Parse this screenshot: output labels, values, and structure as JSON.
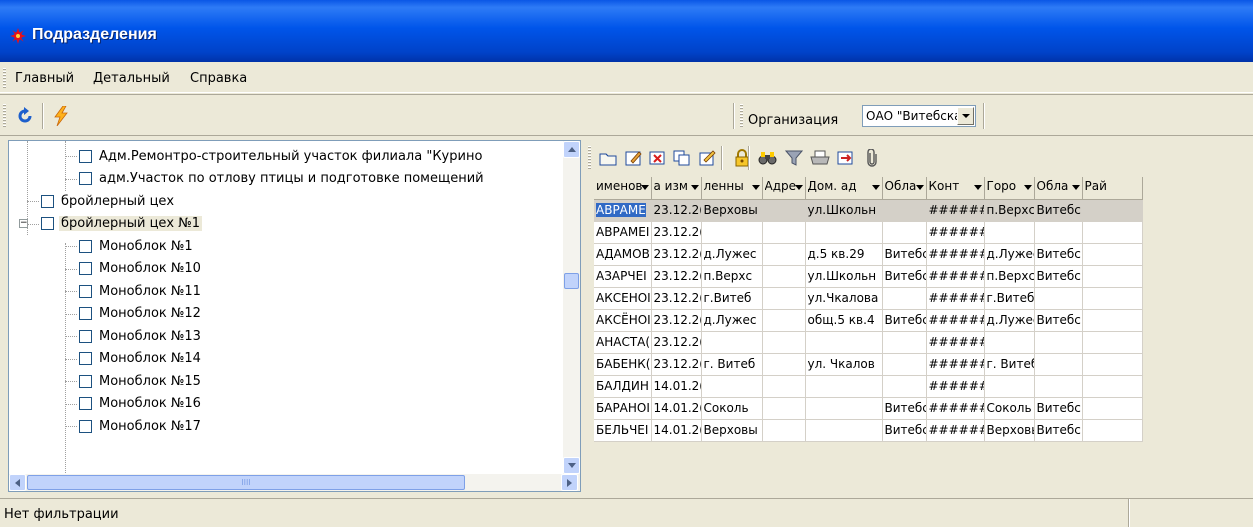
{
  "window": {
    "title": "Подразделения",
    "icon": "red-sun-app-icon"
  },
  "menu": {
    "items": [
      "Главный",
      "Детальный",
      "Справка"
    ]
  },
  "toolbar": {
    "buttons": [
      "refresh-icon",
      "lightning-icon"
    ],
    "org_label": "Организация",
    "org_value": "ОАО \"Витебская бройлерная птиц"
  },
  "tree": {
    "items": [
      {
        "label": "Адм.Ремонтро-строительный участок филиала \"Курино",
        "level": 2
      },
      {
        "label": "адм.Участок по отлову птицы и подготовке помещений",
        "level": 2
      },
      {
        "label": "бройлерный цех",
        "level": 1
      },
      {
        "label": "бройлерный цех №1",
        "level": 1,
        "expanded": true,
        "selected": true
      },
      {
        "label": "Моноблок №1",
        "level": 2
      },
      {
        "label": "Моноблок №10",
        "level": 2
      },
      {
        "label": "Моноблок №11",
        "level": 2
      },
      {
        "label": "Моноблок №12",
        "level": 2
      },
      {
        "label": "Моноблок №13",
        "level": 2
      },
      {
        "label": "Моноблок №14",
        "level": 2
      },
      {
        "label": "Моноблок №15",
        "level": 2
      },
      {
        "label": "Моноблок №16",
        "level": 2
      },
      {
        "label": "Моноблок №17",
        "level": 2
      }
    ],
    "hscroll_marker": "IIII"
  },
  "grid_toolbar": {
    "buttons": [
      "folder-icon",
      "edit-icon",
      "delete-icon",
      "copy-icon",
      "edit-note-icon",
      "lock-icon",
      "binoculars-icon",
      "filter-icon",
      "print-icon",
      "export-icon",
      "paperclip-icon"
    ]
  },
  "grid": {
    "columns": [
      "именов",
      "а изм",
      "ленны",
      "Адре",
      "Дом. ад",
      "Обла",
      "Конт",
      "Горо",
      "Обла",
      "Рай"
    ],
    "rows": [
      [
        "АВРАМЕ",
        "23.12.2(",
        "Верховы",
        "",
        "ул.Школьн",
        "",
        "#######",
        "п.Верхс",
        "Витебсі",
        ""
      ],
      [
        "АВРАМЕІ",
        "23.12.2(",
        "",
        "",
        "",
        "",
        "#######",
        "",
        "",
        ""
      ],
      [
        "АДАМОВ",
        "23.12.2(",
        "д.Лужес",
        "",
        "д.5 кв.29",
        "Витебсі",
        "#######",
        "д.Лужес",
        "Витебсі",
        ""
      ],
      [
        "АЗАРЧЕІ",
        "23.12.2(",
        "п.Верхс",
        "",
        "ул.Школьн",
        "Витебсі",
        "#######",
        "п.Верхс",
        "Витебсі",
        ""
      ],
      [
        "АКСЕНОІ",
        "23.12.2(",
        "г.Витеб",
        "",
        "ул.Чкалова",
        "",
        "#######",
        "г.Витеб",
        "",
        ""
      ],
      [
        "АКСЁНОІ",
        "23.12.2(",
        "д.Лужес",
        "",
        "общ.5 кв.4",
        "Витебсі",
        "#######",
        "д.Лужес",
        "Витебсі",
        ""
      ],
      [
        "АНАСТА(",
        "23.12.2(",
        "",
        "",
        "",
        "",
        "#######",
        "",
        "",
        ""
      ],
      [
        "БАБЕНК(",
        "23.12.2(",
        "г. Витеб",
        "",
        "ул. Чкалов",
        "",
        "#######",
        "г. Витеб",
        "",
        ""
      ],
      [
        "БАЛДИН",
        "14.01.2(",
        "",
        "",
        "",
        "",
        "#######",
        "",
        "",
        ""
      ],
      [
        "БАРАНОІ",
        "14.01.2(",
        "Соколь",
        "",
        "",
        "Витебсі",
        "#######",
        "Соколь",
        "Витебсі",
        ""
      ],
      [
        "БЕЛЬЧЕІ",
        "14.01.2(",
        "Верховы",
        "",
        "",
        "Витебсі",
        "#######",
        "Верховы",
        "Витебсі",
        ""
      ]
    ]
  },
  "status": {
    "text": "Нет фильтрации"
  }
}
